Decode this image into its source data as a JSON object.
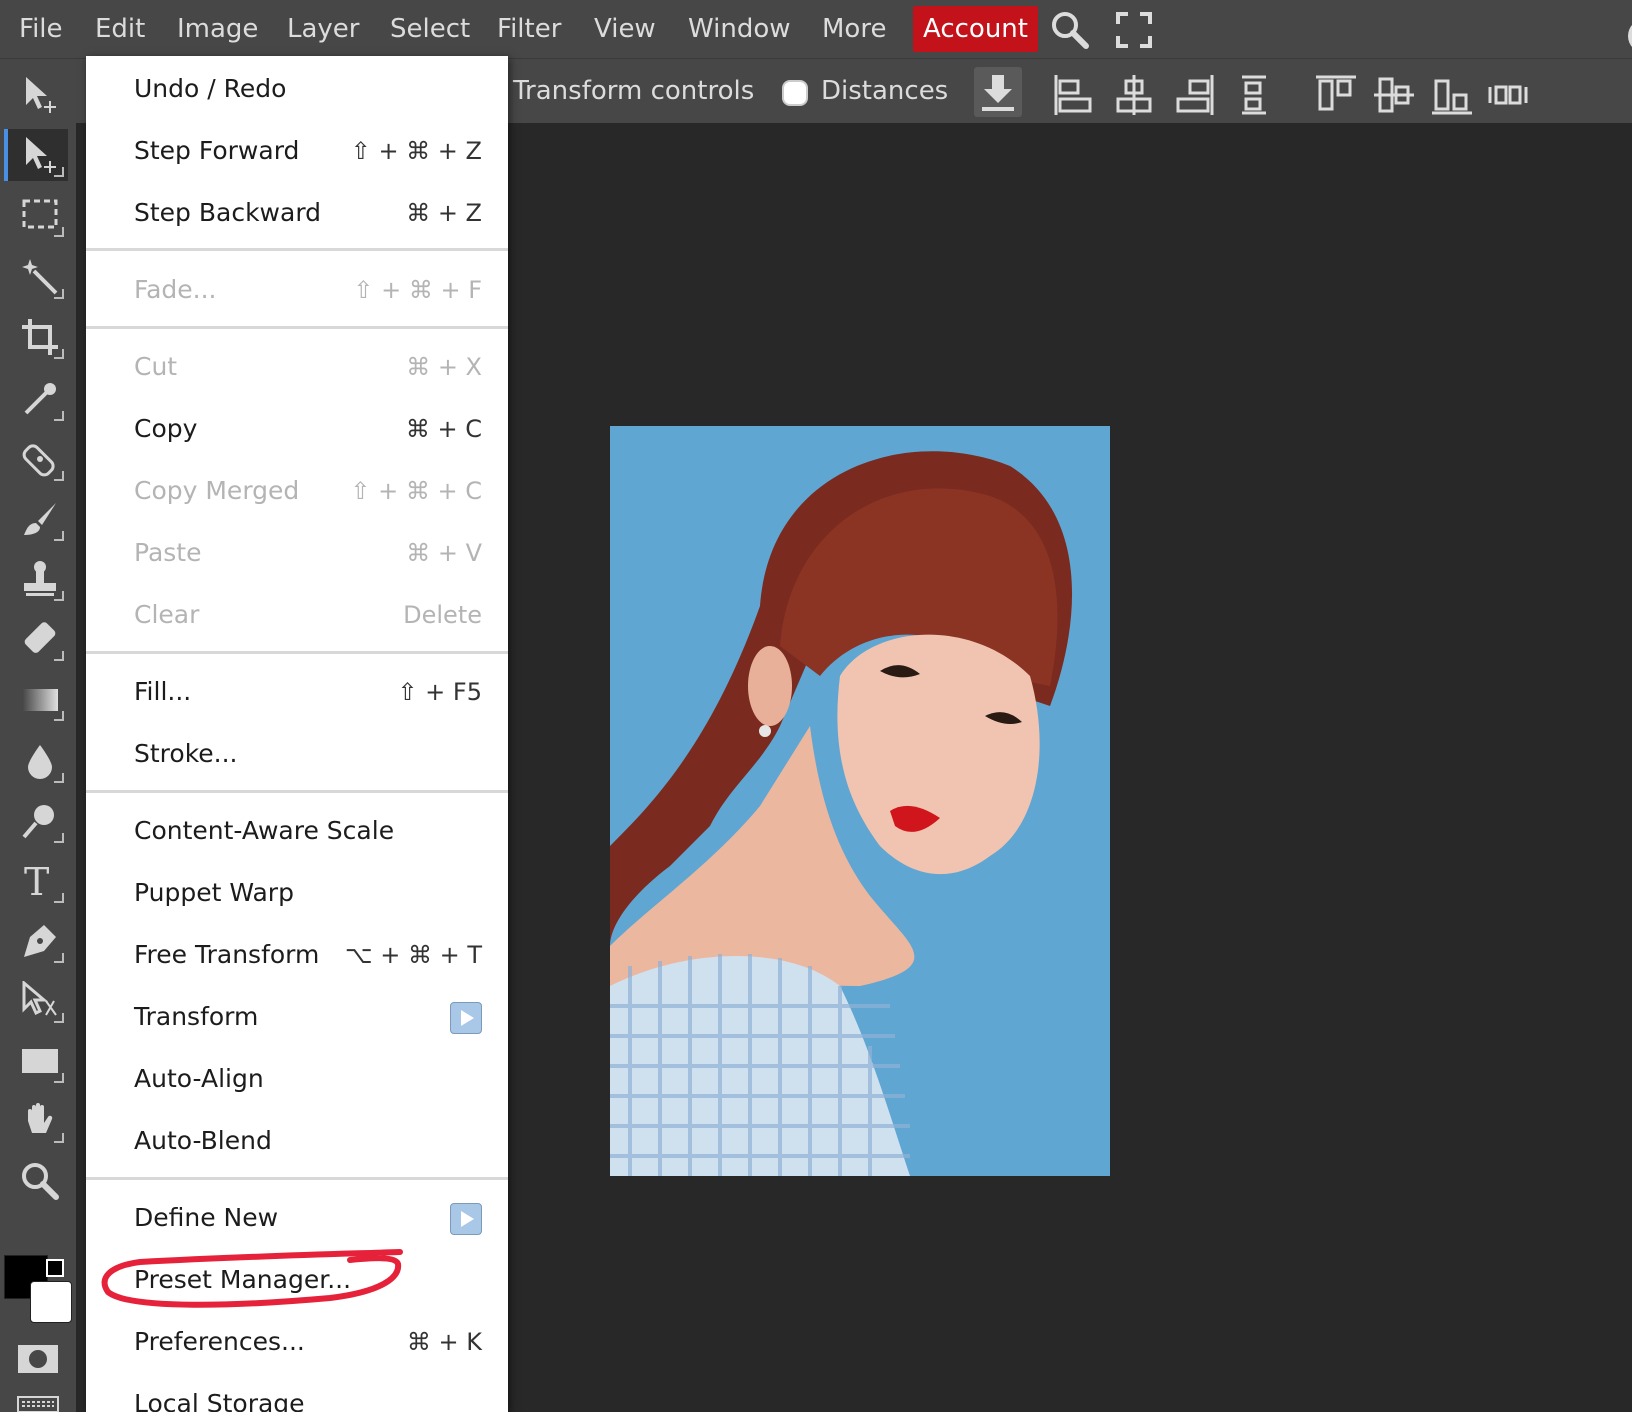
{
  "menubar": {
    "items": [
      {
        "label": "File"
      },
      {
        "label": "Edit"
      },
      {
        "label": "Image"
      },
      {
        "label": "Layer"
      },
      {
        "label": "Select"
      },
      {
        "label": "Filter"
      },
      {
        "label": "View"
      },
      {
        "label": "Window"
      },
      {
        "label": "More"
      },
      {
        "label": "Account"
      }
    ],
    "icons": [
      "search-icon",
      "fullscreen-icon"
    ]
  },
  "options": {
    "transform_label": "Transform controls",
    "distances_label": "Distances",
    "distances_checked": false
  },
  "colors": {
    "foreground": "#000000",
    "background": "#ffffff",
    "account_bg": "#c4121a",
    "annotation": "#e6213a"
  },
  "tools": [
    "move-tool-icon",
    "select-move-icon",
    "marquee-icon",
    "magic-wand-icon",
    "crop-icon",
    "eyedropper-icon",
    "healing-icon",
    "brush-icon",
    "stamp-icon",
    "eraser-icon",
    "gradient-icon",
    "blur-icon",
    "sponge-icon",
    "text-icon",
    "pen-icon",
    "path-select-icon",
    "shape-icon",
    "hand-icon",
    "zoom-icon"
  ],
  "edit_menu": {
    "items": [
      {
        "label": "Undo / Redo",
        "shortcut": ""
      },
      {
        "label": "Step Forward",
        "shortcut": "⇧ + ⌘ + Z"
      },
      {
        "label": "Step Backward",
        "shortcut": "⌘ + Z"
      },
      {
        "label": "Fade...",
        "shortcut": "⇧ + ⌘ + F"
      },
      {
        "label": "Cut",
        "shortcut": "⌘ + X"
      },
      {
        "label": "Copy",
        "shortcut": "⌘ + C"
      },
      {
        "label": "Copy Merged",
        "shortcut": "⇧ + ⌘ + C"
      },
      {
        "label": "Paste",
        "shortcut": "⌘ + V"
      },
      {
        "label": "Clear",
        "shortcut": "Delete"
      },
      {
        "label": "Fill...",
        "shortcut": "⇧ + F5"
      },
      {
        "label": "Stroke...",
        "shortcut": ""
      },
      {
        "label": "Content-Aware Scale",
        "shortcut": ""
      },
      {
        "label": "Puppet Warp",
        "shortcut": ""
      },
      {
        "label": "Free Transform",
        "shortcut": "⌥ + ⌘ + T"
      },
      {
        "label": "Transform",
        "shortcut": ""
      },
      {
        "label": "Auto-Align",
        "shortcut": ""
      },
      {
        "label": "Auto-Blend",
        "shortcut": ""
      },
      {
        "label": "Define New",
        "shortcut": ""
      },
      {
        "label": "Preset Manager...",
        "shortcut": ""
      },
      {
        "label": "Preferences...",
        "shortcut": "⌘ + K"
      },
      {
        "label": "Local Storage",
        "shortcut": ""
      }
    ]
  }
}
